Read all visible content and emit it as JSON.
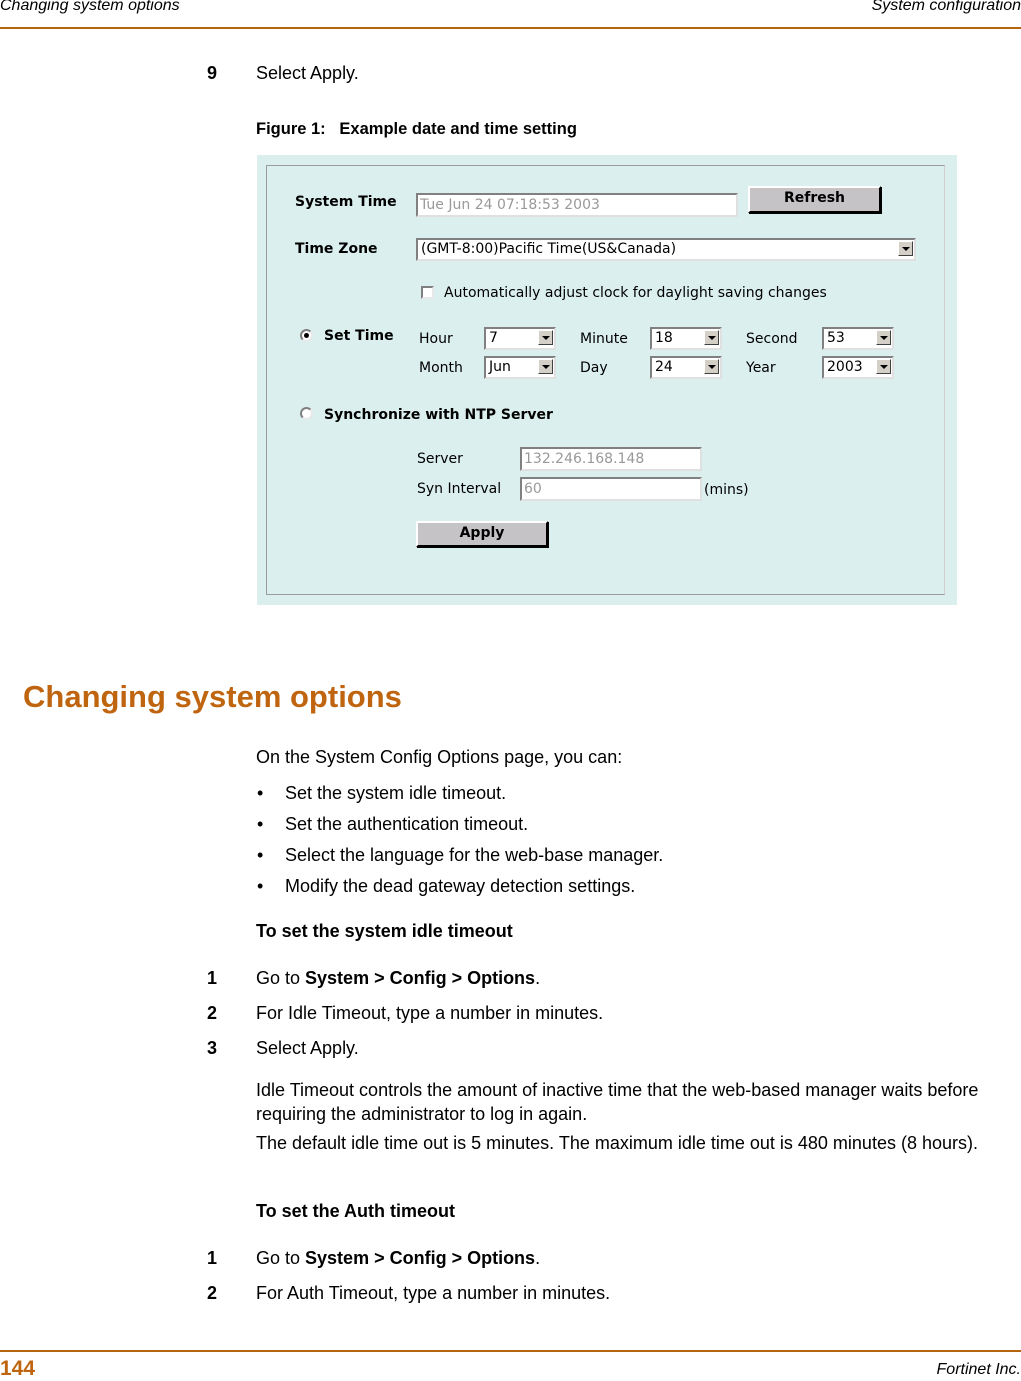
{
  "header": {
    "left": "Changing system options",
    "right": "System configuration"
  },
  "step_prev": {
    "num": "9",
    "text": "Select Apply."
  },
  "figure": {
    "caption": "Figure 1:   Example date and time setting",
    "system_time_label": "System Time",
    "system_time_value": "Tue Jun 24 07:18:53 2003",
    "refresh_label": "Refresh",
    "time_zone_label": "Time Zone",
    "time_zone_value": "(GMT-8:00)Pacific Time(US&Canada)",
    "dst_label": "Automatically adjust clock for daylight saving changes",
    "dst_checked": false,
    "set_time_label": "Set Time",
    "set_time_selected": true,
    "fields": {
      "hour_label": "Hour",
      "hour_value": "7",
      "minute_label": "Minute",
      "minute_value": "18",
      "second_label": "Second",
      "second_value": "53",
      "month_label": "Month",
      "month_value": "Jun",
      "day_label": "Day",
      "day_value": "24",
      "year_label": "Year",
      "year_value": "2003"
    },
    "ntp_label": "Synchronize with NTP Server",
    "ntp_selected": false,
    "server_label": "Server",
    "server_value": "132.246.168.148",
    "interval_label": "Syn Interval",
    "interval_value": "60",
    "interval_unit": "(mins)",
    "apply_label": "Apply"
  },
  "section": {
    "title": "Changing system options",
    "intro": "On the System Config Options page, you can:",
    "bullets": [
      "Set the system idle timeout.",
      "Set the authentication timeout.",
      "Select the language for the web-base manager.",
      "Modify the dead gateway detection settings."
    ],
    "bullet_char": "•",
    "proc1": {
      "title": "To set the system idle timeout",
      "steps": [
        {
          "num": "1",
          "pre": "Go to ",
          "bold": "System > Config > Options",
          "post": "."
        },
        {
          "num": "2",
          "text": "For Idle Timeout, type a number in minutes."
        },
        {
          "num": "3",
          "text": "Select Apply."
        }
      ],
      "note1": "Idle Timeout controls the amount of inactive time that the web-based manager waits before requiring the administrator to log in again.",
      "note2": "The default idle time out is 5 minutes. The maximum idle time out is 480 minutes (8 hours)."
    },
    "proc2": {
      "title": "To set the Auth timeout",
      "steps": [
        {
          "num": "1",
          "pre": "Go to ",
          "bold": "System > Config > Options",
          "post": "."
        },
        {
          "num": "2",
          "text": "For Auth Timeout, type a number in minutes."
        }
      ]
    }
  },
  "footer": {
    "page_number": "144",
    "company": "Fortinet Inc."
  },
  "colors": {
    "accent": "#b5640f",
    "section_title": "#c0650f",
    "figure_bg": "#dcefef"
  }
}
